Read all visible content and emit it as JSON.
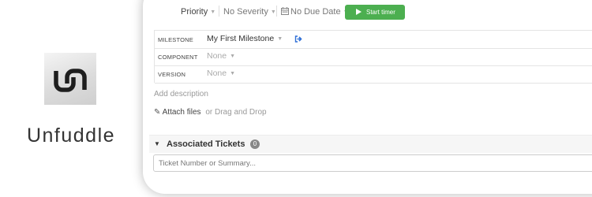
{
  "brand": {
    "name": "Unfuddle",
    "logo_icon": "unfuddle-logo-icon"
  },
  "toolbar": {
    "priority_label": "Priority",
    "severity_label": "No Severity",
    "due_date_label": "No Due Date",
    "timer_button_label": "Start timer"
  },
  "fields": {
    "milestone_label": "MILESTONE",
    "milestone_value": "My First Milestone",
    "component_label": "COMPONENT",
    "component_value": "None",
    "version_label": "VERSION",
    "version_value": "None"
  },
  "description": {
    "add_label": "Add description"
  },
  "attachments": {
    "attach_label": "Attach files",
    "drag_label": "or Drag and Drop"
  },
  "associated": {
    "title": "Associated Tickets",
    "count": "0",
    "input_placeholder": "Ticket Number or Summary..."
  },
  "colors": {
    "timer_button": "#4caf50",
    "link_icon": "#2f6fd6",
    "count_badge": "#888888"
  }
}
